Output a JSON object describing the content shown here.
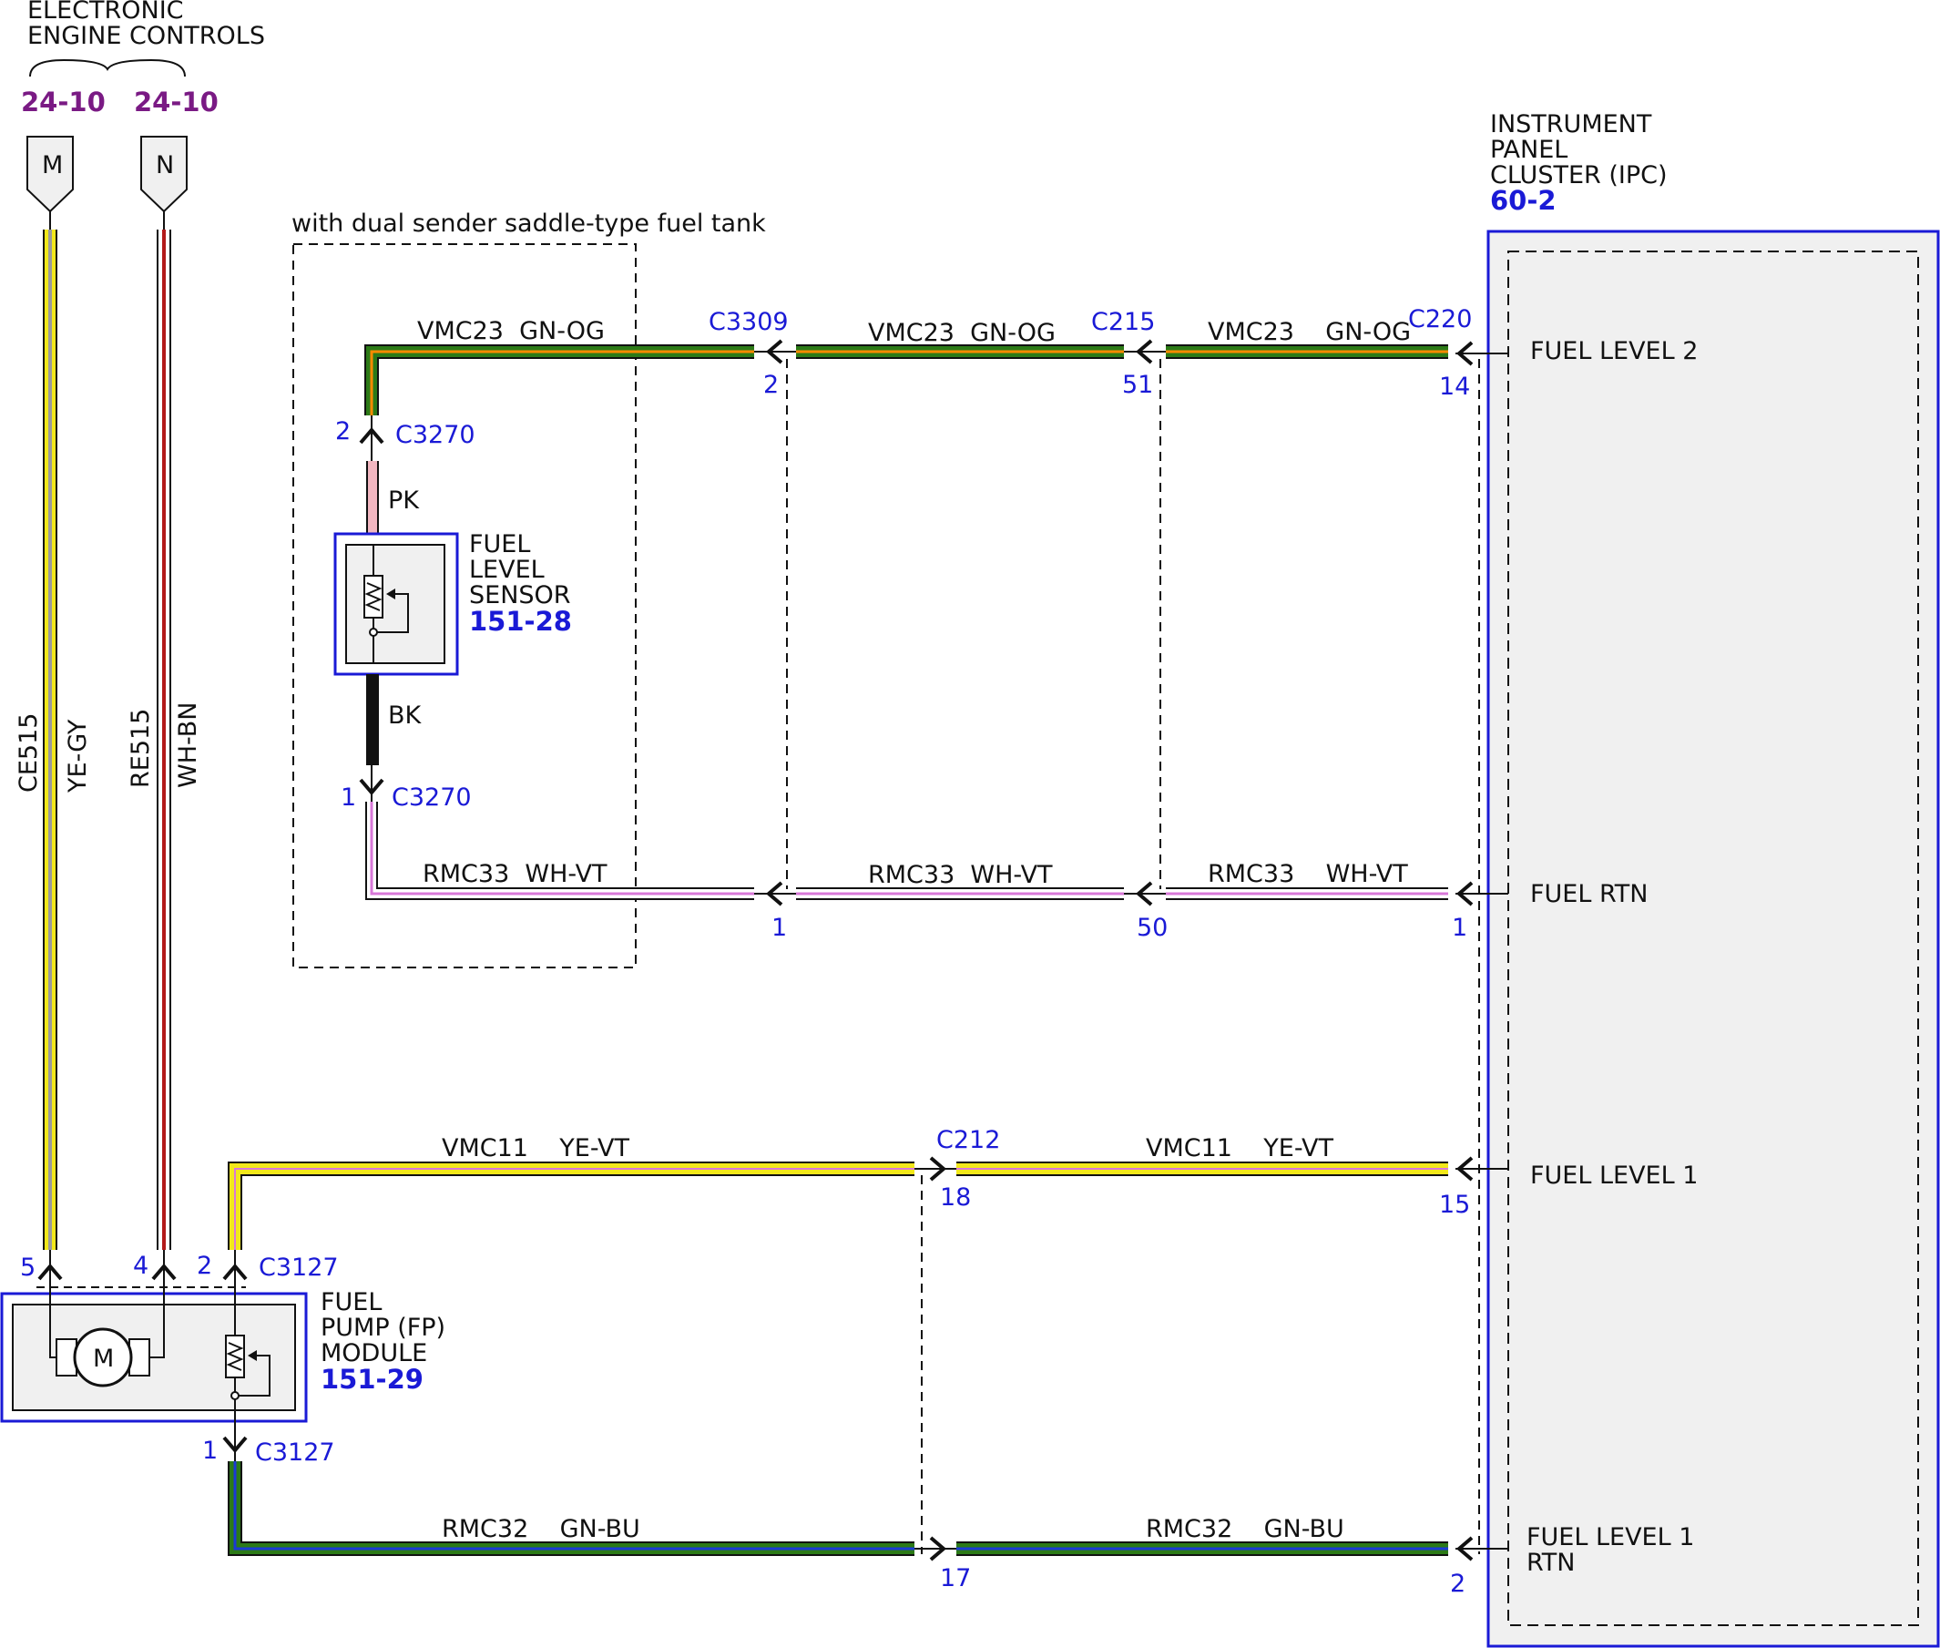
{
  "colors": {
    "yellow": "#f2e81a",
    "green": "#2c7a17",
    "pink": "#f1b6c0",
    "white": "#ffffff",
    "violet": "#d878d8",
    "blue": "#0000ff",
    "brown": "#b31a1a",
    "orange": "#ff8a00",
    "gray": "#9a9a9a",
    "module_fill": "#f0f0f0",
    "module_border": "#1a1ad6",
    "page_ref": "#7a1a84"
  },
  "eec": {
    "title_line1": "ELECTRONIC",
    "title_line2": "ENGINE CONTROLS",
    "ref_m": "24-10",
    "ref_n": "24-10",
    "tab_m": "M",
    "tab_n": "N"
  },
  "ipc": {
    "line1": "INSTRUMENT",
    "line2": "PANEL",
    "line3": "CLUSTER (IPC)",
    "ref": "60-2",
    "fuel_level_2": "FUEL LEVEL 2",
    "fuel_rtn": "FUEL RTN",
    "fuel_level_1": "FUEL LEVEL 1",
    "fuel_level_1_rtn_line1": "FUEL LEVEL 1",
    "fuel_level_1_rtn_line2": "RTN"
  },
  "tank_option": "with dual sender saddle-type fuel tank",
  "sensor": {
    "line1": "FUEL",
    "line2": "LEVEL",
    "line3": "SENSOR",
    "ref": "151-28"
  },
  "pump": {
    "line1": "FUEL",
    "line2": "PUMP (FP)",
    "line3": "MODULE",
    "ref": "151-29",
    "motor": "M"
  },
  "wires": {
    "ce515": "CE515",
    "ye_gy": "YE-GY",
    "re515": "RE515",
    "wh_bn": "WH-BN",
    "pk": "PK",
    "bk": "BK",
    "vmc23_a": "VMC23  GN-OG",
    "vmc23_b": "VMC23  GN-OG",
    "vmc23_c": "VMC23    GN-OG",
    "rmc33_a": "RMC33  WH-VT",
    "rmc33_b": "RMC33  WH-VT",
    "rmc33_c": "RMC33    WH-VT",
    "vmc11_a": "VMC11    YE-VT",
    "vmc11_b": "VMC11    YE-VT",
    "rmc32_a": "RMC32    GN-BU",
    "rmc32_b": "RMC32    GN-BU"
  },
  "connectors": {
    "c3309": "C3309",
    "c215": "C215",
    "c220": "C220",
    "c3270_top": "C3270",
    "c3270_bot": "C3270",
    "c212": "C212",
    "c3127_top": "C3127",
    "c3127_bot": "C3127"
  },
  "pins": {
    "c3309_2": "2",
    "c215_51": "51",
    "c220_14": "14",
    "c3270_2": "2",
    "c3270_1": "1",
    "c3309_1": "1",
    "c215_50": "50",
    "c220_1": "1",
    "c212_18": "18",
    "c220_15": "15",
    "c212_17": "17",
    "c220_2": "2",
    "fp_5": "5",
    "fp_4": "4",
    "fp_2": "2",
    "fp_1": "1"
  }
}
